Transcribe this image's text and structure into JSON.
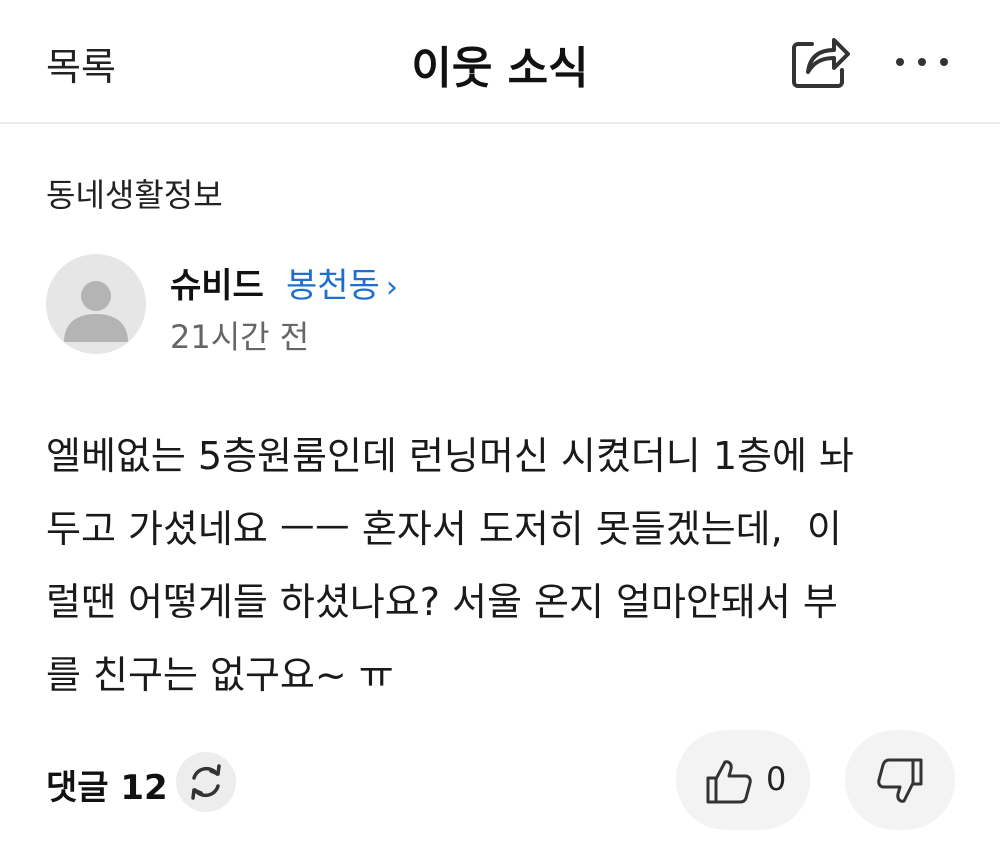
{
  "header": {
    "back_label": "목록",
    "title": "이웃 소식",
    "share_icon": "share-icon",
    "more_icon": "more-icon"
  },
  "post": {
    "category": "동네생활정보",
    "author": {
      "name": "슈비드",
      "location": "봉천동",
      "time": "21시간 전",
      "avatar_icon": "user-avatar-icon"
    },
    "body_lines": [
      "엘베없는 5층원룸인데 런닝머신 시켰더니 1층에 놔",
      "두고 가셨네요 ㅡㅡ 혼자서 도저히 못들겠는데,  이",
      "럴땐 어떻게들 하셨나요? 서울 온지 얼마안돼서 부",
      "를 친구는 없구요~ ㅠ"
    ]
  },
  "footer": {
    "comments_label": "댓글 12",
    "refresh_icon": "refresh-icon",
    "like_count": "0",
    "like_icon": "thumbs-up-icon",
    "dislike_icon": "thumbs-down-icon"
  },
  "colors": {
    "accent": "#1f6fd1",
    "divider": "#ececec",
    "button_bg": "#f3f3f3"
  }
}
